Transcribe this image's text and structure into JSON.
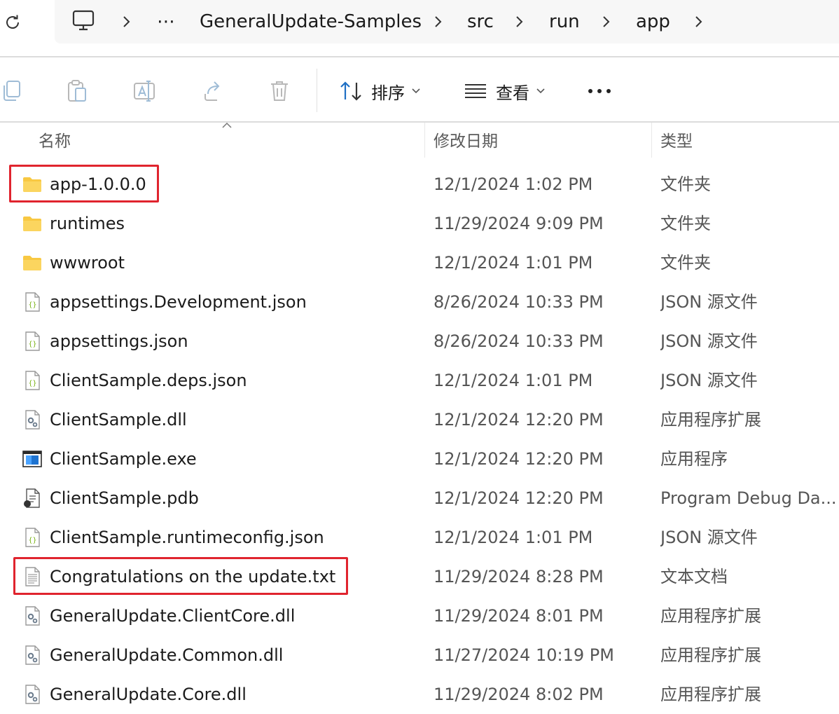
{
  "breadcrumb": {
    "ellipsis": "⋯",
    "items": [
      "GeneralUpdate-Samples",
      "src",
      "run",
      "app"
    ]
  },
  "toolbar": {
    "sort_label": "排序",
    "view_label": "查看",
    "more_label": "•••"
  },
  "columns": {
    "name": "名称",
    "modified": "修改日期",
    "type": "类型"
  },
  "files": [
    {
      "name": "app-1.0.0.0",
      "modified": "12/1/2024 1:02 PM",
      "type": "文件夹",
      "icon": "folder-icon",
      "highlighted": true
    },
    {
      "name": "runtimes",
      "modified": "11/29/2024 9:09 PM",
      "type": "文件夹",
      "icon": "folder-icon"
    },
    {
      "name": "wwwroot",
      "modified": "12/1/2024 1:01 PM",
      "type": "文件夹",
      "icon": "folder-icon"
    },
    {
      "name": "appsettings.Development.json",
      "modified": "8/26/2024 10:33 PM",
      "type": "JSON 源文件",
      "icon": "json-file-icon"
    },
    {
      "name": "appsettings.json",
      "modified": "8/26/2024 10:33 PM",
      "type": "JSON 源文件",
      "icon": "json-file-icon"
    },
    {
      "name": "ClientSample.deps.json",
      "modified": "12/1/2024 1:01 PM",
      "type": "JSON 源文件",
      "icon": "json-file-icon"
    },
    {
      "name": "ClientSample.dll",
      "modified": "12/1/2024 12:20 PM",
      "type": "应用程序扩展",
      "icon": "dll-file-icon"
    },
    {
      "name": "ClientSample.exe",
      "modified": "12/1/2024 12:20 PM",
      "type": "应用程序",
      "icon": "exe-file-icon"
    },
    {
      "name": "ClientSample.pdb",
      "modified": "12/1/2024 12:20 PM",
      "type": "Program Debug Da...",
      "icon": "pdb-file-icon"
    },
    {
      "name": "ClientSample.runtimeconfig.json",
      "modified": "12/1/2024 1:01 PM",
      "type": "JSON 源文件",
      "icon": "json-file-icon"
    },
    {
      "name": "Congratulations on the update.txt",
      "modified": "11/29/2024 8:28 PM",
      "type": "文本文档",
      "icon": "text-file-icon",
      "highlighted": true
    },
    {
      "name": "GeneralUpdate.ClientCore.dll",
      "modified": "11/29/2024 8:01 PM",
      "type": "应用程序扩展",
      "icon": "dll-file-icon"
    },
    {
      "name": "GeneralUpdate.Common.dll",
      "modified": "11/27/2024 10:19 PM",
      "type": "应用程序扩展",
      "icon": "dll-file-icon"
    },
    {
      "name": "GeneralUpdate.Core.dll",
      "modified": "11/29/2024 8:02 PM",
      "type": "应用程序扩展",
      "icon": "dll-file-icon"
    }
  ],
  "colors": {
    "highlight": "#e0242e",
    "folder": "#f8c842",
    "accent": "#1e6fc4"
  }
}
